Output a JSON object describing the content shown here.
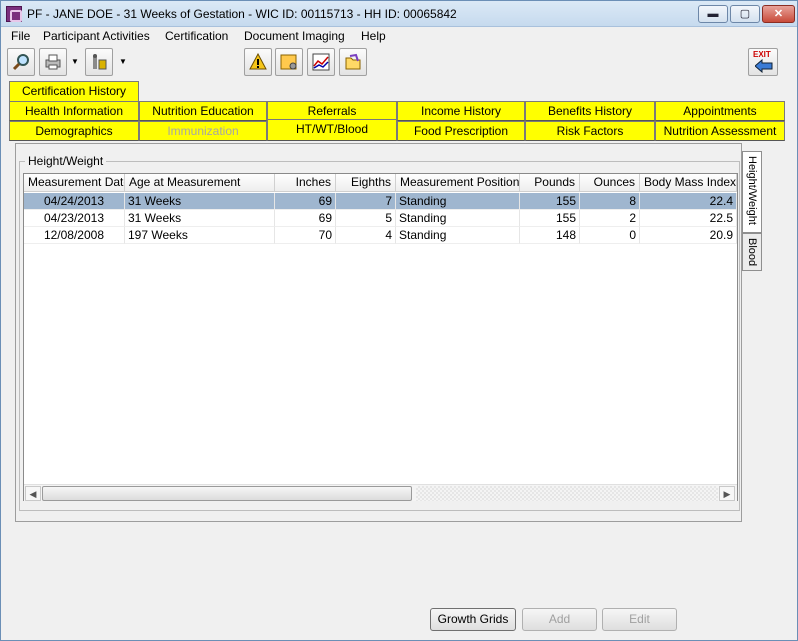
{
  "window": {
    "title": "PF - JANE DOE - 31 Weeks of Gestation - WIC ID: 00115713 - HH ID: 00065842"
  },
  "menu": {
    "items": [
      "File",
      "Participant Activities",
      "Certification",
      "Document Imaging",
      "Help"
    ]
  },
  "toolbar": {
    "exit_label": "EXIT"
  },
  "tabs": {
    "row0": [
      "Certification History"
    ],
    "row1": [
      "Health Information",
      "Nutrition Education",
      "Referrals",
      "Income History",
      "Benefits History",
      "Appointments"
    ],
    "row2": [
      "Demographics",
      "Immunization",
      "HT/WT/Blood",
      "Food Prescription",
      "Risk Factors",
      "Nutrition Assessment"
    ]
  },
  "group": {
    "label": "Height/Weight"
  },
  "side_tabs": {
    "height_weight": "Height/Weight",
    "blood": "Blood"
  },
  "grid": {
    "columns": [
      "Measurement Date",
      "Age at Measurement",
      "Inches",
      "Eighths",
      "Measurement Position",
      "Pounds",
      "Ounces",
      "Body Mass Index"
    ],
    "rows": [
      [
        "04/24/2013",
        "31 Weeks",
        "69",
        "7",
        "Standing",
        "155",
        "8",
        "22.4"
      ],
      [
        "04/23/2013",
        "31 Weeks",
        "69",
        "5",
        "Standing",
        "155",
        "2",
        "22.5"
      ],
      [
        "12/08/2008",
        "197 Weeks",
        "70",
        "4",
        "Standing",
        "148",
        "0",
        "20.9"
      ]
    ]
  },
  "buttons": {
    "growth_grids": "Growth Grids",
    "add": "Add",
    "edit": "Edit"
  }
}
